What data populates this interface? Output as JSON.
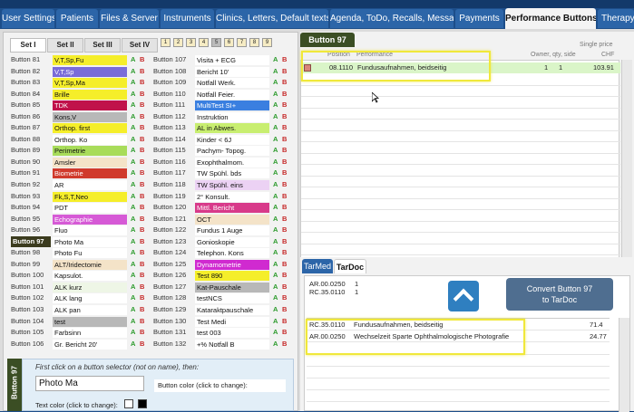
{
  "tabs": [
    {
      "label": "User Settings"
    },
    {
      "label": "Patients"
    },
    {
      "label": "Files & Server"
    },
    {
      "label": "Instruments"
    },
    {
      "label": "Clinics, Letters, Default texts"
    },
    {
      "label": "Agenda, ToDo, Recalls, Messages"
    },
    {
      "label": "Payments"
    },
    {
      "label": "Performance Buttons"
    },
    {
      "label": "Therapy B"
    }
  ],
  "sets": [
    {
      "label": "Set I"
    },
    {
      "label": "Set II"
    },
    {
      "label": "Set III"
    },
    {
      "label": "Set IV"
    }
  ],
  "page_numbers": [
    "1",
    "2",
    "3",
    "4",
    "5",
    "6",
    "7",
    "8",
    "9"
  ],
  "ab": {
    "a": "A",
    "b": "B"
  },
  "buttons_left": [
    {
      "label": "Button 81",
      "name": "V,T,Sp,Fu",
      "color": "#f5ee2a"
    },
    {
      "label": "Button 82",
      "name": "V,T,Sp",
      "color": "#7a6cd8"
    },
    {
      "label": "Button 83",
      "name": "V,T,Sp,Ma",
      "color": "#f5ee2a"
    },
    {
      "label": "Button 84",
      "name": "Brille",
      "color": "#f5ee2a"
    },
    {
      "label": "Button 85",
      "name": "TDK",
      "color": "#c0124a"
    },
    {
      "label": "Button 86",
      "name": "Kons,V",
      "color": "#b8b8b8"
    },
    {
      "label": "Button 87",
      "name": "Orthop. first",
      "color": "#f5ee2a"
    },
    {
      "label": "Button 88",
      "name": "Orthop. Ko",
      "color": "#ffffff"
    },
    {
      "label": "Button 89",
      "name": "Perimetrie",
      "color": "#a8dc5a"
    },
    {
      "label": "Button 90",
      "name": "Amsler",
      "color": "#f4e3c8"
    },
    {
      "label": "Button 91",
      "name": "Biometrie",
      "color": "#d03a2c"
    },
    {
      "label": "Button 92",
      "name": "AR",
      "color": "#ffffff"
    },
    {
      "label": "Button 93",
      "name": "Fk,S,T,Neo",
      "color": "#f5ee2a"
    },
    {
      "label": "Button 94",
      "name": "PDT",
      "color": "#ffffff"
    },
    {
      "label": "Button 95",
      "name": "Echographie",
      "color": "#d65ad6"
    },
    {
      "label": "Button 96",
      "name": "Fluo",
      "color": "#ffffff"
    },
    {
      "label": "Button 97",
      "name": "Photo Ma",
      "color": "#ffffff"
    },
    {
      "label": "Button 98",
      "name": "Photo Fu",
      "color": "#ffffff"
    },
    {
      "label": "Button 99",
      "name": "ALT/Iridectomie",
      "color": "#f4e3c8"
    },
    {
      "label": "Button 100",
      "name": "Kapsulot.",
      "color": "#ffffff"
    },
    {
      "label": "Button 101",
      "name": "ALK kurz",
      "color": "#eef6e6"
    },
    {
      "label": "Button 102",
      "name": "ALK lang",
      "color": "#ffffff"
    },
    {
      "label": "Button 103",
      "name": "ALK pan",
      "color": "#ffffff"
    },
    {
      "label": "Button 104",
      "name": "test",
      "color": "#b8b8b8"
    },
    {
      "label": "Button 105",
      "name": "Farbsinn",
      "color": "#ffffff"
    },
    {
      "label": "Button 106",
      "name": "Gr. Bericht 20'",
      "color": "#ffffff"
    }
  ],
  "buttons_right": [
    {
      "label": "Button 107",
      "name": "Visita + ECG",
      "color": "#ffffff"
    },
    {
      "label": "Button 108",
      "name": "Bericht 10'",
      "color": "#ffffff"
    },
    {
      "label": "Button 109",
      "name": "Notfall Werk.",
      "color": "#ffffff"
    },
    {
      "label": "Button 110",
      "name": "Notfall Feier.",
      "color": "#ffffff"
    },
    {
      "label": "Button 111",
      "name": "MultiTest SI+",
      "color": "#3a7fe0"
    },
    {
      "label": "Button 112",
      "name": "Instruktion",
      "color": "#ffffff"
    },
    {
      "label": "Button 113",
      "name": "AL in Abwes.",
      "color": "#c8ee70"
    },
    {
      "label": "Button 114",
      "name": "Kinder < 6J",
      "color": "#ffffff"
    },
    {
      "label": "Button 115",
      "name": "Pachym- Topog.",
      "color": "#ffffff"
    },
    {
      "label": "Button 116",
      "name": "Exophthalmom.",
      "color": "#ffffff"
    },
    {
      "label": "Button 117",
      "name": "TW Spühl. bds",
      "color": "#ffffff"
    },
    {
      "label": "Button 118",
      "name": "TW Spühl. eins",
      "color": "#ecd2f4"
    },
    {
      "label": "Button 119",
      "name": "2° Konsult.",
      "color": "#ffffff"
    },
    {
      "label": "Button 120",
      "name": "Mittl. Bericht",
      "color": "#d83a8a"
    },
    {
      "label": "Button 121",
      "name": "OCT",
      "color": "#f4e3c8"
    },
    {
      "label": "Button 122",
      "name": "Fundus 1 Auge",
      "color": "#ffffff"
    },
    {
      "label": "Button 123",
      "name": "Gonioskopie",
      "color": "#ffffff"
    },
    {
      "label": "Button 124",
      "name": "Telephon. Kons",
      "color": "#ffffff"
    },
    {
      "label": "Button 125",
      "name": "Dynamometrie",
      "color": "#d02ad0"
    },
    {
      "label": "Button 126",
      "name": "Test 890",
      "color": "#f5ee2a"
    },
    {
      "label": "Button 127",
      "name": "Kat-Pauschale",
      "color": "#b8b8b8"
    },
    {
      "label": "Button 128",
      "name": "testNCS",
      "color": "#ffffff"
    },
    {
      "label": "Button 129",
      "name": "Kataraktpauschale",
      "color": "#ffffff"
    },
    {
      "label": "Button 130",
      "name": "Test Medi",
      "color": "#ffffff"
    },
    {
      "label": "Button 131",
      "name": "test 003",
      "color": "#ffffff"
    },
    {
      "label": "Button 132",
      "name": "+% Notfall B",
      "color": "#ffffff"
    }
  ],
  "selected_index_left": 16,
  "edit": {
    "sidebar": "Button 97",
    "hint": "First click on a button selector (not on name), then:",
    "name_value": "Photo Ma",
    "button_color_label": "Button color (click to change):",
    "text_color_label": "Text color (click to change):"
  },
  "perf": {
    "tab": "Button 97",
    "single_price_label": "Single price",
    "chf_label": "CHF",
    "col_position": "Position",
    "col_performance": "Performance",
    "col_owner": "Owner, qty, side",
    "row": {
      "position": "08.1110",
      "performance": "Fundusaufnahmen, beidseitig",
      "owner": "1",
      "qty": "1",
      "price": "103.91"
    }
  },
  "tarpanel": {
    "tab_tarmed": "TarMed",
    "tab_tardoc": "TarDoc",
    "codes": [
      {
        "code": "AR.00.0250",
        "qty": "1"
      },
      {
        "code": "RC.35.0110",
        "qty": "1"
      }
    ],
    "convert_label_line1": "Convert Button 97",
    "convert_label_line2": "to TarDoc",
    "rows": [
      {
        "code": "RC.35.0110",
        "desc": "Fundusaufnahmen, beidseitig",
        "price": "71.4"
      },
      {
        "code": "AR.00.0250",
        "desc": "Wechselzeit Sparte Ophthalmologische Photografie",
        "price": "24.77"
      }
    ]
  }
}
